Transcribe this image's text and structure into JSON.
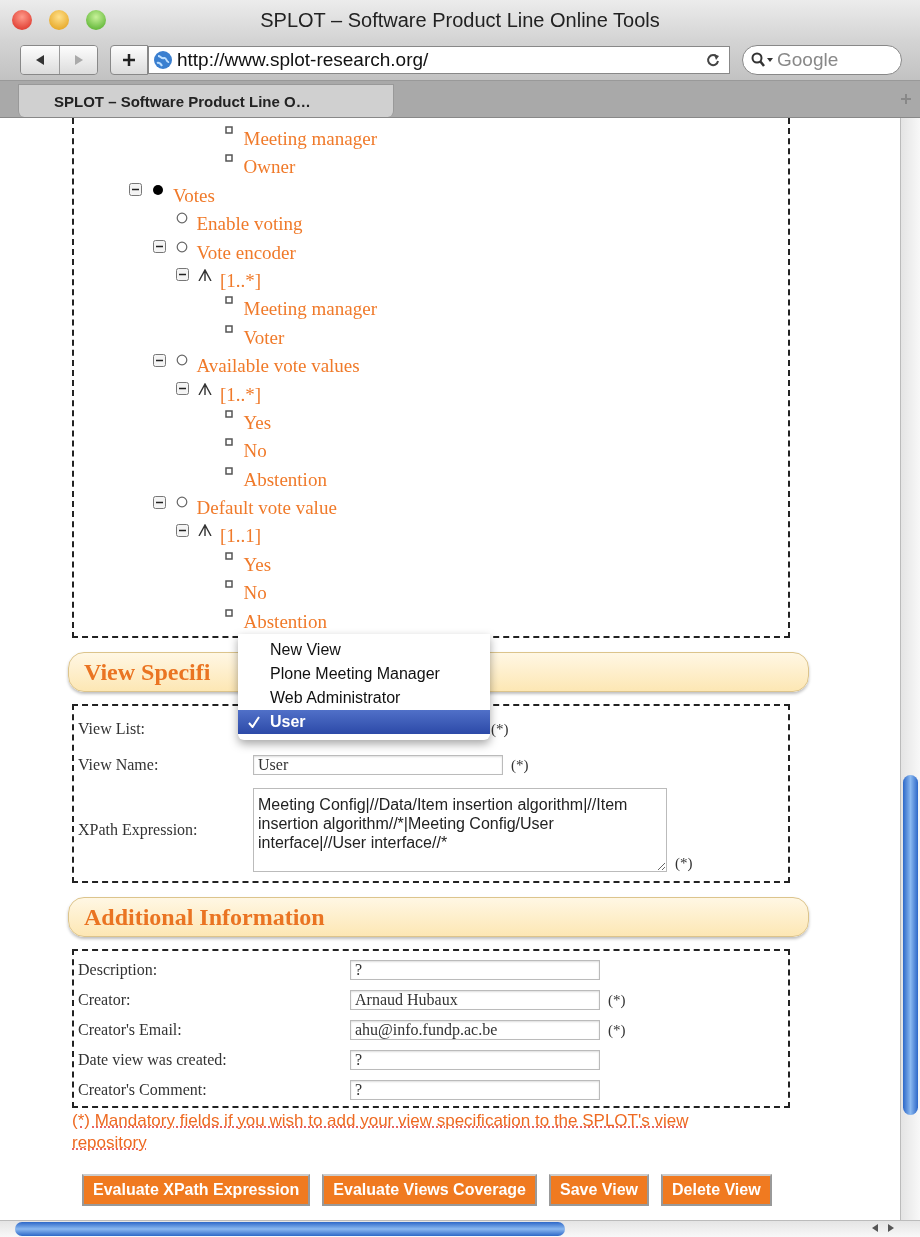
{
  "window": {
    "title": "SPLOT – Software Product Line Online Tools"
  },
  "toolbar": {
    "url": "http://www.splot-research.org/",
    "search": {
      "placeholder": "Google"
    }
  },
  "tabs": [
    {
      "label": "SPLOT – Software Product Line O…",
      "selected": true
    }
  ],
  "tree": {
    "clipped_items": [
      {
        "label": "Meeting manager",
        "kind": "leaf"
      },
      {
        "label": "Owner",
        "kind": "leaf"
      }
    ],
    "items": [
      {
        "label": "Votes",
        "kind": "mandatory",
        "expanded": true,
        "children": [
          {
            "label": "Enable voting",
            "kind": "optional"
          },
          {
            "label": "Vote encoder",
            "kind": "optional",
            "expanded": true,
            "children": [
              {
                "label": "[1..*]",
                "kind": "group",
                "expanded": true,
                "children": [
                  {
                    "label": "Meeting manager",
                    "kind": "leaf"
                  },
                  {
                    "label": "Voter",
                    "kind": "leaf"
                  }
                ]
              }
            ]
          },
          {
            "label": "Available vote values",
            "kind": "optional",
            "expanded": true,
            "children": [
              {
                "label": "[1..*]",
                "kind": "group",
                "expanded": true,
                "children": [
                  {
                    "label": "Yes",
                    "kind": "leaf"
                  },
                  {
                    "label": "No",
                    "kind": "leaf"
                  },
                  {
                    "label": "Abstention",
                    "kind": "leaf"
                  }
                ]
              }
            ]
          },
          {
            "label": "Default vote value",
            "kind": "optional",
            "expanded": true,
            "children": [
              {
                "label": "[1..1]",
                "kind": "group",
                "expanded": true,
                "children": [
                  {
                    "label": "Yes",
                    "kind": "leaf"
                  },
                  {
                    "label": "No",
                    "kind": "leaf"
                  },
                  {
                    "label": "Abstention",
                    "kind": "leaf"
                  }
                ]
              }
            ]
          }
        ]
      }
    ]
  },
  "view_specification": {
    "title": "View Specifi",
    "fields": [
      {
        "label": "View List:",
        "kind": "select",
        "mark": "(*)"
      },
      {
        "label": "View Name:",
        "kind": "text",
        "value": "User",
        "mark": "(*)"
      },
      {
        "label": "XPath Expression:",
        "kind": "textarea",
        "value": "Meeting Config|//Data/Item insertion algorithm|//Item insertion algorithm//*|Meeting Config/User interface|//User interface//*",
        "mark": "(*)"
      }
    ]
  },
  "dropdown": {
    "options": [
      {
        "label": "New View",
        "selected": false
      },
      {
        "label": "Plone Meeting Manager",
        "selected": false
      },
      {
        "label": "Web Administrator",
        "selected": false
      },
      {
        "label": "User",
        "selected": true
      }
    ]
  },
  "additional_information": {
    "title": "Additional Information",
    "fields": [
      {
        "label": "Description:",
        "value": "?"
      },
      {
        "label": "Creator:",
        "value": "Arnaud Hubaux",
        "mark": "(*)"
      },
      {
        "label": "Creator's Email:",
        "value": "ahu@info.fundp.ac.be",
        "mark": "(*)"
      },
      {
        "label": "Date view was created:",
        "value": "?"
      },
      {
        "label": "Creator's Comment:",
        "value": "?"
      }
    ]
  },
  "note": "(*) Mandatory fields if you wish to add your view specification to the SPLOT's view repository",
  "buttons": [
    "Evaluate XPath Expression",
    "Evaluate Views Coverage",
    "Save View",
    "Delete View"
  ]
}
